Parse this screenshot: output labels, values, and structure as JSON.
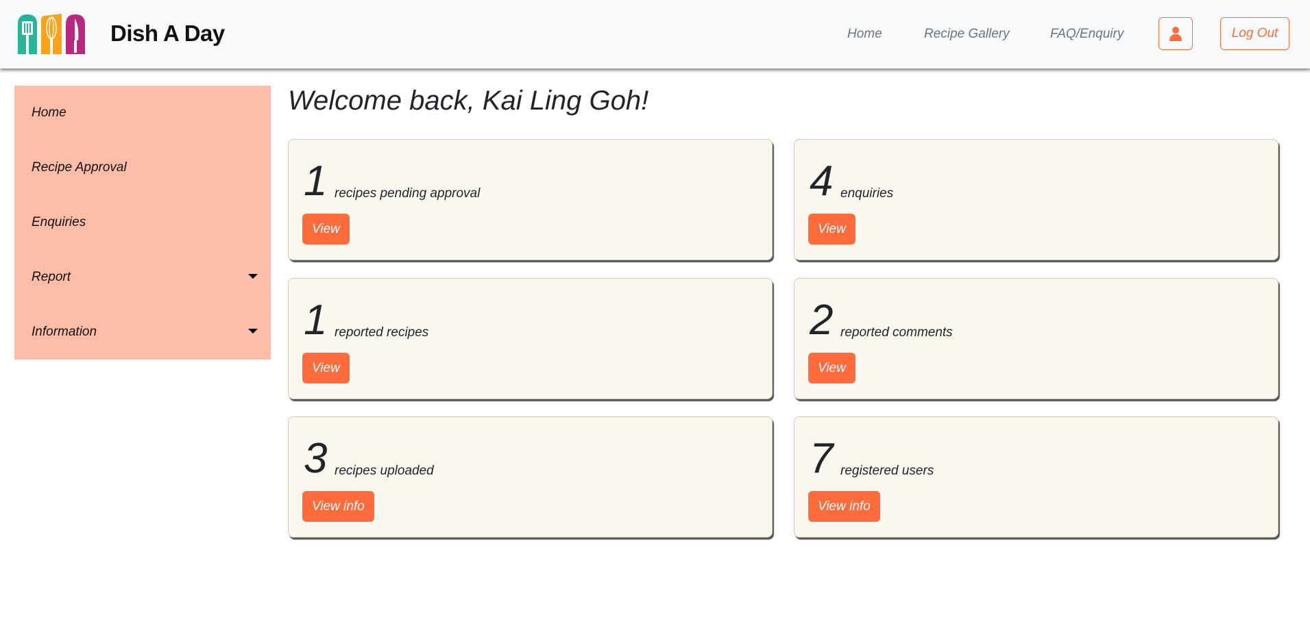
{
  "header": {
    "brand": "Dish A Day",
    "nav": [
      {
        "label": "Home"
      },
      {
        "label": "Recipe Gallery"
      },
      {
        "label": "FAQ/Enquiry"
      }
    ],
    "profile_icon": "user-icon",
    "logout_label": "Log Out",
    "accent_color": "#ff6b3b"
  },
  "sidebar": {
    "background": "#fdbda8",
    "items": [
      {
        "label": "Home",
        "has_dropdown": false
      },
      {
        "label": "Recipe Approval",
        "has_dropdown": false
      },
      {
        "label": "Enquiries",
        "has_dropdown": false
      },
      {
        "label": "Report",
        "has_dropdown": true
      },
      {
        "label": "Information",
        "has_dropdown": true
      }
    ]
  },
  "main": {
    "welcome": "Welcome back, Kai Ling Goh!",
    "cards": [
      {
        "count": "1",
        "label": "recipes pending approval",
        "button": "View"
      },
      {
        "count": "4",
        "label": "enquiries",
        "button": "View"
      },
      {
        "count": "1",
        "label": "reported recipes",
        "button": "View"
      },
      {
        "count": "2",
        "label": "reported comments",
        "button": "View"
      },
      {
        "count": "3",
        "label": "recipes uploaded",
        "button": "View info"
      },
      {
        "count": "7",
        "label": "registered users",
        "button": "View info"
      }
    ]
  }
}
